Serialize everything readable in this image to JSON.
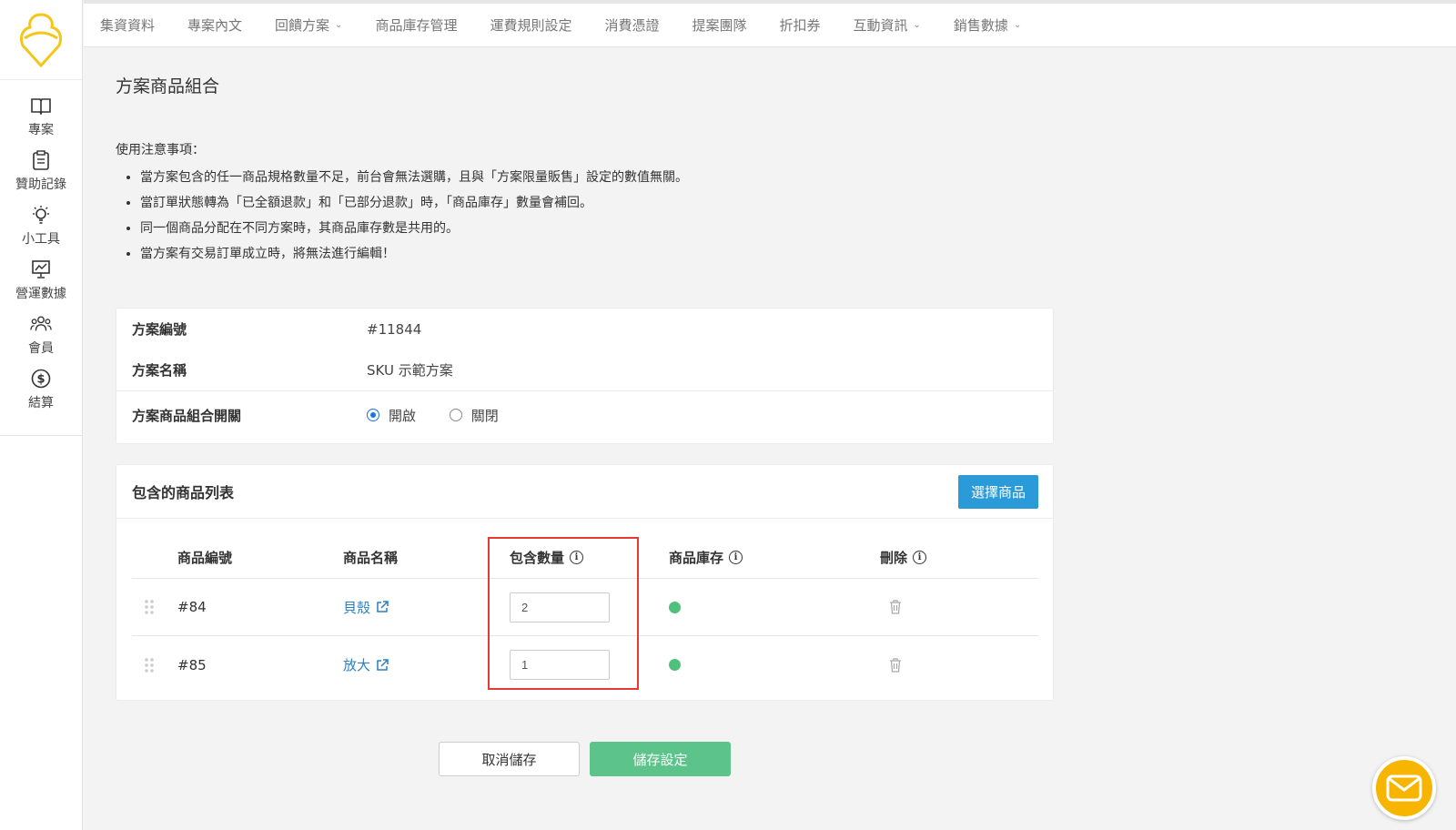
{
  "sidebar": {
    "items": [
      {
        "label": "專案",
        "icon": "book-icon"
      },
      {
        "label": "贊助記錄",
        "icon": "clipboard-icon"
      },
      {
        "label": "小工具",
        "icon": "lightbulb-icon"
      },
      {
        "label": "營運數據",
        "icon": "chart-icon"
      },
      {
        "label": "會員",
        "icon": "users-icon"
      },
      {
        "label": "結算",
        "icon": "dollar-icon"
      }
    ]
  },
  "topnav": {
    "items": [
      {
        "label": "集資資料"
      },
      {
        "label": "專案內文"
      },
      {
        "label": "回饋方案",
        "dropdown": true
      },
      {
        "label": "商品庫存管理"
      },
      {
        "label": "運費規則設定"
      },
      {
        "label": "消費憑證"
      },
      {
        "label": "提案團隊"
      },
      {
        "label": "折扣券"
      },
      {
        "label": "互動資訊",
        "dropdown": true
      },
      {
        "label": "銷售數據",
        "dropdown": true
      }
    ]
  },
  "page": {
    "title": "方案商品組合",
    "notes_title": "使用注意事項：",
    "notes": [
      "當方案包含的任一商品規格數量不足，前台會無法選購，且與「方案限量販售」設定的數值無關。",
      "當訂單狀態轉為「已全額退款」和「已部分退款」時，「商品庫存」數量會補回。",
      "同一個商品分配在不同方案時，其商品庫存數是共用的。",
      "當方案有交易訂單成立時，將無法進行編輯！"
    ]
  },
  "info": {
    "plan_id_label": "方案編號",
    "plan_id_value": "#11844",
    "plan_name_label": "方案名稱",
    "plan_name_value": "SKU 示範方案",
    "switch_label": "方案商品組合開關",
    "on_label": "開啟",
    "off_label": "關閉",
    "selected": "on"
  },
  "product_list": {
    "title": "包含的商品列表",
    "select_button": "選擇商品",
    "columns": {
      "id": "商品編號",
      "name": "商品名稱",
      "qty": "包含數量",
      "stock": "商品庫存",
      "delete": "刪除"
    },
    "rows": [
      {
        "id": "#84",
        "name": "貝殼",
        "qty": "2",
        "stock_status": "in-stock"
      },
      {
        "id": "#85",
        "name": "放大",
        "qty": "1",
        "stock_status": "in-stock"
      }
    ]
  },
  "actions": {
    "cancel": "取消儲存",
    "save": "儲存設定"
  },
  "colors": {
    "accent_blue": "#2b9ad8",
    "save_green": "#5cc48a",
    "stock_green": "#4fc17d",
    "highlight_red": "#e53935",
    "chat_yellow": "#f7b500"
  }
}
